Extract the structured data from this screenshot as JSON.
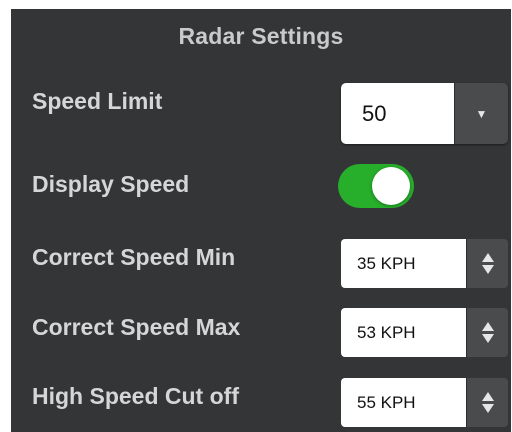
{
  "title": "Radar Settings",
  "speed_limit": {
    "label": "Speed Limit",
    "value": "50",
    "dropdown_icon": "chevron-down-icon"
  },
  "display_speed": {
    "label": "Display Speed",
    "enabled": true,
    "on_color": "#27ae2b"
  },
  "correct_speed_min": {
    "label": "Correct Speed Min",
    "value": "35 KPH"
  },
  "correct_speed_max": {
    "label": "Correct Speed Max",
    "value": "53 KPH"
  },
  "high_speed_cut_off": {
    "label": "High Speed Cut off",
    "value": "55 KPH"
  },
  "colors": {
    "panel_bg": "#333537",
    "label_text": "#d5d6d7",
    "toggle_on": "#27ae2b"
  }
}
